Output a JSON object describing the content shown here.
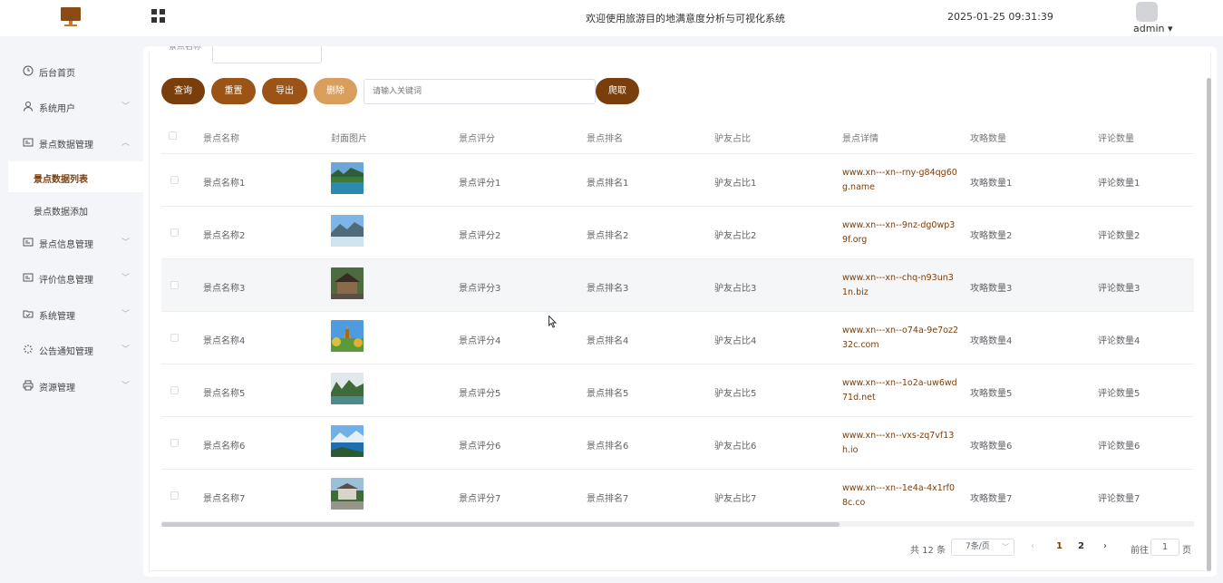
{
  "header": {
    "system_title": "欢迎使用旅游目的地满意度分析与可视化系统",
    "datetime": "2025-01-25 09:31:39",
    "user": "admin ▾"
  },
  "sidebar": {
    "items": [
      {
        "label": "后台首页",
        "icon": "clock-icon"
      },
      {
        "label": "系统用户",
        "icon": "user-icon",
        "arrow": "﹀"
      },
      {
        "label": "景点数据管理",
        "icon": "card-icon",
        "arrow": "︿"
      },
      {
        "label": "景点信息管理",
        "icon": "card-icon",
        "arrow": "﹀"
      },
      {
        "label": "评价信息管理",
        "icon": "card-icon",
        "arrow": "﹀"
      },
      {
        "label": "系统管理",
        "icon": "folder-icon",
        "arrow": "﹀"
      },
      {
        "label": "公告通知管理",
        "icon": "loading-icon",
        "arrow": "﹀"
      },
      {
        "label": "资源管理",
        "icon": "printer-icon",
        "arrow": "﹀"
      }
    ],
    "sub_items": [
      {
        "label": "景点数据列表",
        "active": true
      },
      {
        "label": "景点数据添加",
        "active": false
      }
    ]
  },
  "search": {
    "label": "景点名称"
  },
  "toolbar": {
    "query": "查询",
    "reset": "重置",
    "export": "导出",
    "delete": "删除",
    "keyword_placeholder": "请输入关键词",
    "crawl": "爬取"
  },
  "table": {
    "headers": [
      "景点名称",
      "封面图片",
      "景点评分",
      "景点排名",
      "驴友占比",
      "景点详情",
      "攻略数量",
      "评论数量"
    ],
    "rows": [
      {
        "name": "景点名称1",
        "score": "景点评分1",
        "rank": "景点排名1",
        "ratio": "驴友占比1",
        "detail": "www.xn---xn--rny-g84qg60g.name",
        "guides": "攻略数量1",
        "comments": "评论数量1",
        "image": "lake-forest"
      },
      {
        "name": "景点名称2",
        "score": "景点评分2",
        "rank": "景点排名2",
        "ratio": "驴友占比2",
        "detail": "www.xn---xn--9nz-dg0wp39f.org",
        "guides": "攻略数量2",
        "comments": "评论数量2",
        "image": "mountain-sky"
      },
      {
        "name": "景点名称3",
        "score": "景点评分3",
        "rank": "景点排名3",
        "ratio": "驴友占比3",
        "detail": "www.xn---xn--chq-n93un31n.biz",
        "guides": "攻略数量3",
        "comments": "评论数量3",
        "image": "old-house"
      },
      {
        "name": "景点名称4",
        "score": "景点评分4",
        "rank": "景点排名4",
        "ratio": "驴友占比4",
        "detail": "www.xn---xn--o74a-9e7oz232c.com",
        "guides": "攻略数量4",
        "comments": "评论数量4",
        "image": "pagoda"
      },
      {
        "name": "景点名称5",
        "score": "景点评分5",
        "rank": "景点排名5",
        "ratio": "驴友占比5",
        "detail": "www.xn---xn--1o2a-uw6wd71d.net",
        "guides": "攻略数量5",
        "comments": "评论数量5",
        "image": "river-hills"
      },
      {
        "name": "景点名称6",
        "score": "景点评分6",
        "rank": "景点排名6",
        "ratio": "驴友占比6",
        "detail": "www.xn---xn--vxs-zq7vf13h.io",
        "guides": "攻略数量6",
        "comments": "评论数量6",
        "image": "blue-lake"
      },
      {
        "name": "景点名称7",
        "score": "景点评分7",
        "rank": "景点排名7",
        "ratio": "驴友占比7",
        "detail": "www.xn---xn--1e4a-4x1rf08c.co",
        "guides": "攻略数量7",
        "comments": "评论数量7",
        "image": "gate-building"
      }
    ]
  },
  "pagination": {
    "total": "共 12 条",
    "page_size": "7条/页",
    "prev": "‹",
    "pages": [
      "1",
      "2"
    ],
    "current": "1",
    "next": "›",
    "goto_label": "前往",
    "goto_value": "1",
    "page_suffix": "页"
  },
  "colors": {
    "primary": "#7a3e0c",
    "secondary": "#9b5416",
    "light": "#d99d5c"
  }
}
